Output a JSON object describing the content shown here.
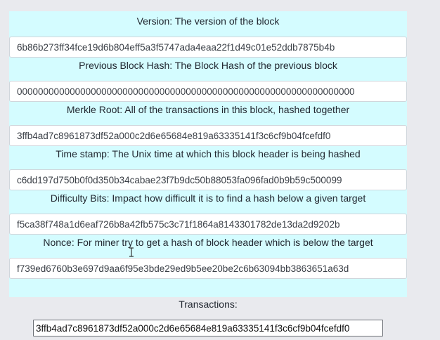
{
  "block": {
    "fields": [
      {
        "label": "Version: The version of the block",
        "value": "6b86b273ff34fce19d6b804eff5a3f5747ada4eaa22f1d49c01e52ddb7875b4b"
      },
      {
        "label": "Previous Block Hash: The Block Hash of the previous block",
        "value": "0000000000000000000000000000000000000000000000000000000000000000"
      },
      {
        "label": "Merkle Root: All of the transactions in this block, hashed together",
        "value": "3ffb4ad7c8961873df52a000c2d6e65684e819a63335141f3c6cf9b04fcefdf0"
      },
      {
        "label": "Time stamp: The Unix time at which this block header is being hashed",
        "value": "c6dd197d750b0f0d350b34cabae23f7b9dc50b88053fa096fad0b9b59c500099"
      },
      {
        "label": "Difficulty Bits: Impact how difficult it is to find a hash below a given target",
        "value": "f5ca38f748a1d6eaf726b8a42fb575c3c71f1864a8143301782de13da2d9202b"
      },
      {
        "label": "Nonce: For miner try to get a hash of block header which is below the target",
        "value": "f739ed6760b3e697d9aa6f95e3bde29ed9b5ee20be2c6b63094bb3863651a63d"
      }
    ]
  },
  "transactions": {
    "label": "Transactions:",
    "value": "3ffb4ad7c8961873df52a000c2d6e65684e819a63335141f3c6cf9b04fcefdf0"
  },
  "colors": {
    "panel_background": "#d4fcff",
    "page_background": "#e9eaee"
  },
  "icons": {
    "cursor": "text-cursor-icon"
  }
}
